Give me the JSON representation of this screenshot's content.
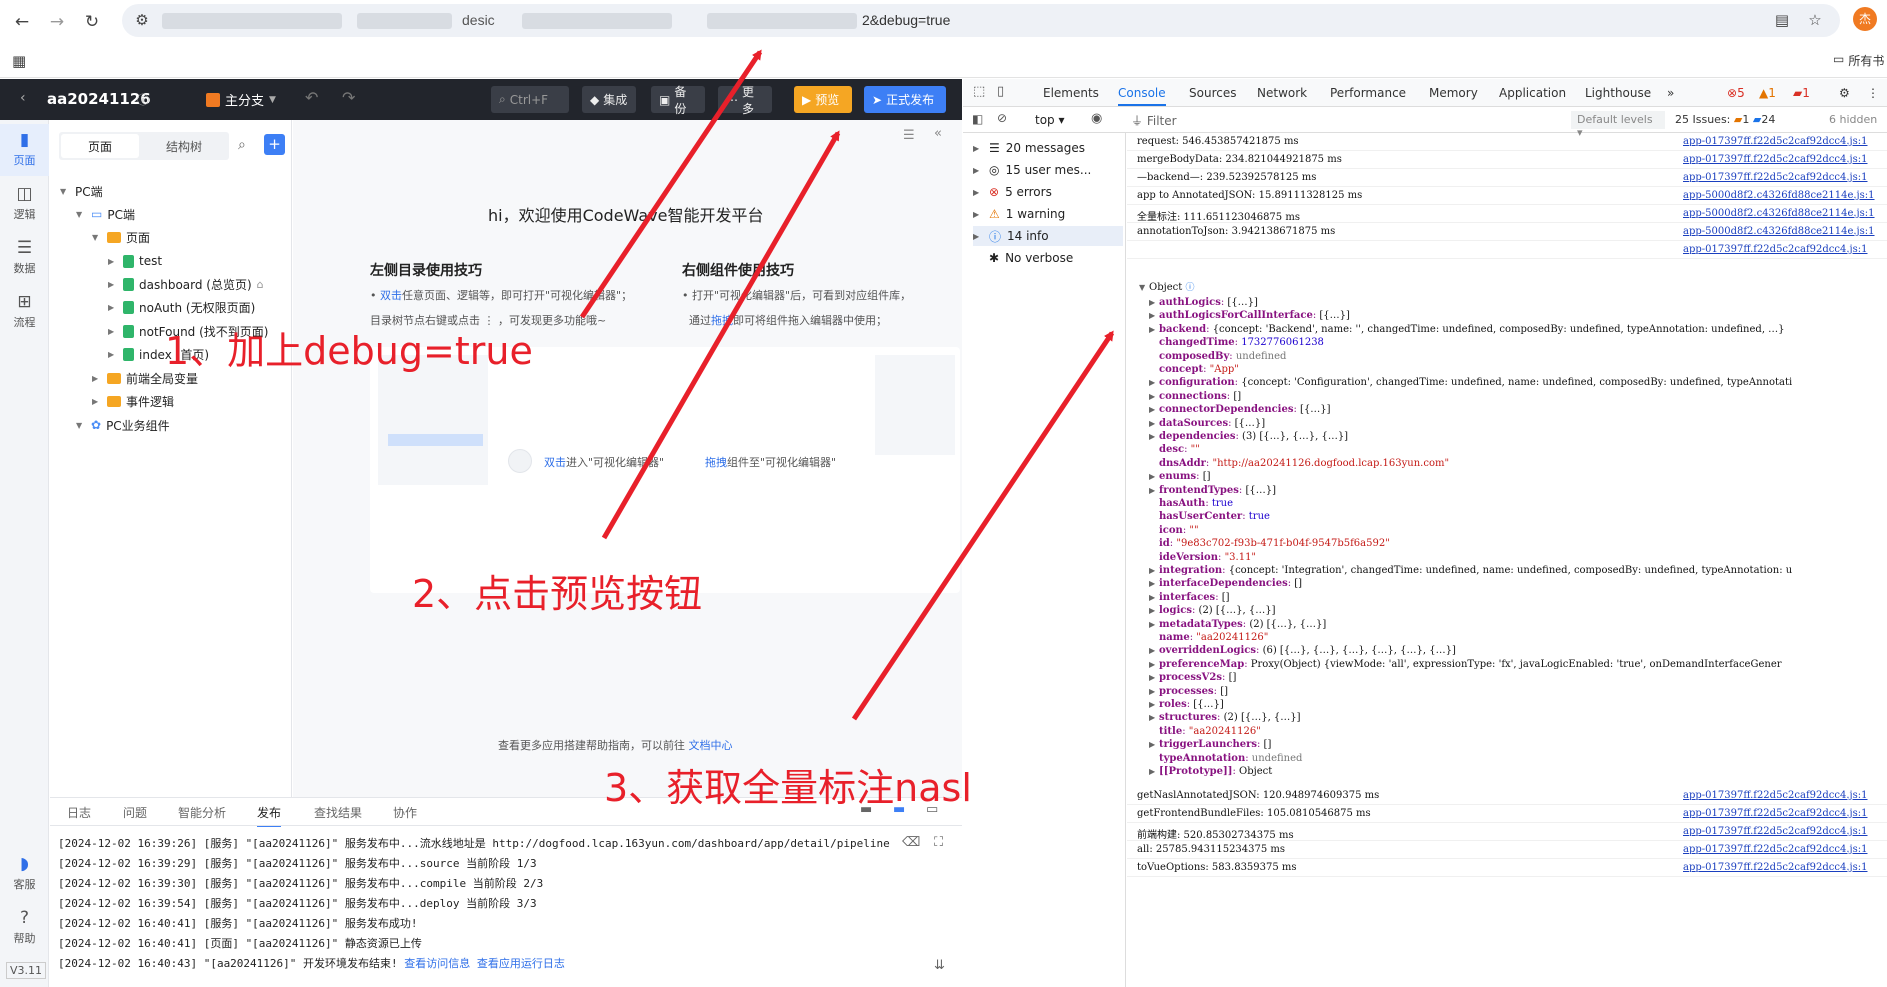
{
  "browser": {
    "url_fragment": "desic",
    "url_tail": "2&debug=true",
    "avatar_text": "杰",
    "bookmark_label": "所有书"
  },
  "ide": {
    "app_name": "aa20241126",
    "branch": "主分支",
    "search_hint": "Ctrl+F",
    "btn_integrate": "集成",
    "btn_backup": "备份",
    "btn_more": "更多",
    "btn_preview": "预览",
    "btn_publish": "正式发布",
    "nav": [
      {
        "label": "页面"
      },
      {
        "label": "逻辑"
      },
      {
        "label": "数据"
      },
      {
        "label": "流程"
      },
      {
        "label": "客服"
      },
      {
        "label": "帮助"
      }
    ],
    "version": "V3.11",
    "tree_tabs": [
      "页面",
      "结构树"
    ],
    "tree": [
      {
        "label": "PC端"
      },
      {
        "label": "PC端"
      },
      {
        "label": "页面"
      },
      {
        "label": "test"
      },
      {
        "label": "dashboard (总览页)"
      },
      {
        "label": "noAuth (无权限页面)"
      },
      {
        "label": "notFound (找不到页面)"
      },
      {
        "label": "index (首页)"
      },
      {
        "label": "前端全局变量"
      },
      {
        "label": "事件逻辑"
      },
      {
        "label": "PC业务组件"
      }
    ],
    "welcome": "hi，欢迎使用CodeWave智能开发平台",
    "tip_left_title": "左侧目录使用技巧",
    "tip_left_1a": "双击",
    "tip_left_1b": "任意页面、逻辑等，即可打开\"可视化编辑器\"；",
    "tip_left_2": "目录树节点右键或点击 ⋮ ，可发现更多功能哦~",
    "tip_right_title": "右侧组件使用技巧",
    "tip_right_1": "打开\"可视化编辑器\"后，可看到对应组件库，",
    "tip_right_2a": "通过",
    "tip_right_2b": "拖拽",
    "tip_right_2c": "即可将组件拖入编辑器中使用；",
    "illus_left_a": "双击",
    "illus_left_b": "进入\"可视化编辑器\"",
    "illus_right_a": "拖拽",
    "illus_right_b": "组件至\"可视化编辑器\"",
    "help_text": "查看更多应用搭建帮助指南，可以前往",
    "help_link": "文档中心",
    "bottom_tabs": [
      "日志",
      "问题",
      "智能分析",
      "发布",
      "查找结果",
      "协作"
    ],
    "logs": [
      "[2024-12-02 16:39:26] [服务] \"[aa20241126]\" 服务发布中...流水线地址是 http://dogfood.lcap.163yun.com/dashboard/app/detail/pipeline",
      "[2024-12-02 16:39:29] [服务] \"[aa20241126]\" 服务发布中...source 当前阶段 1/3",
      "[2024-12-02 16:39:30] [服务] \"[aa20241126]\" 服务发布中...compile 当前阶段 2/3",
      "[2024-12-02 16:39:54] [服务] \"[aa20241126]\" 服务发布中...deploy 当前阶段 3/3",
      "[2024-12-02 16:40:41] [服务] \"[aa20241126]\" 服务发布成功!",
      "[2024-12-02 16:40:41] [页面] \"[aa20241126]\" 静态资源已上传",
      "[2024-12-02 16:40:43]  \"[aa20241126]\" 开发环境发布结束!"
    ],
    "log_link1": "查看访问信息",
    "log_link2": "查看应用运行日志"
  },
  "devtools": {
    "tabs": [
      "Elements",
      "Console",
      "Sources",
      "Network",
      "Performance",
      "Memory",
      "Application",
      "Lighthouse"
    ],
    "err_count": "5",
    "warn_count": "1",
    "issue_count": "1",
    "context": "top",
    "filter_placeholder": "Filter",
    "levels": "Default levels",
    "issues_label": "25 Issues:",
    "issues_a": "1",
    "issues_b": "24",
    "hidden": "6 hidden",
    "sidebar": [
      {
        "label": "20 messages"
      },
      {
        "label": "15 user mes..."
      },
      {
        "label": "5 errors"
      },
      {
        "label": "1 warning"
      },
      {
        "label": "14 info"
      },
      {
        "label": "No verbose"
      }
    ],
    "top_rows": [
      {
        "text": "request: 546.453857421875 ms",
        "src": "app-017397ff.f22d5c2caf92dcc4.js:1"
      },
      {
        "text": "mergeBodyData: 234.821044921875 ms",
        "src": "app-017397ff.f22d5c2caf92dcc4.js:1"
      },
      {
        "text": "—backend—: 239.52392578125 ms",
        "src": "app-017397ff.f22d5c2caf92dcc4.js:1"
      },
      {
        "text": "app to AnnotatedJSON: 15.89111328125 ms",
        "src": "app-5000d8f2.c4326fd88ce2114e.js:1"
      },
      {
        "text": "全量标注: 111.651123046875 ms",
        "src": "app-5000d8f2.c4326fd88ce2114e.js:1"
      },
      {
        "text": "annotationToJson: 3.942138671875 ms",
        "src": "app-5000d8f2.c4326fd88ce2114e.js:1"
      },
      {
        "text": "",
        "src": "app-017397ff.f22d5c2caf92dcc4.js:1"
      }
    ],
    "object_label": "Object",
    "props": [
      {
        "e": true,
        "k": "authLogics",
        "v": "[{…}]"
      },
      {
        "e": true,
        "k": "authLogicsForCallInterface",
        "v": "[{…}]"
      },
      {
        "e": true,
        "k": "backend",
        "v": "{concept: 'Backend', name: '', changedTime: undefined, composedBy: undefined, typeAnnotation: undefined, …}"
      },
      {
        "e": false,
        "k": "changedTime",
        "v": "1732776061238"
      },
      {
        "e": false,
        "k": "composedBy",
        "v": "undefined"
      },
      {
        "e": false,
        "k": "concept",
        "v": "\"App\""
      },
      {
        "e": true,
        "k": "configuration",
        "v": "{concept: 'Configuration', changedTime: undefined, name: undefined, composedBy: undefined, typeAnnotati"
      },
      {
        "e": true,
        "k": "connections",
        "v": "[]"
      },
      {
        "e": true,
        "k": "connectorDependencies",
        "v": "[{…}]"
      },
      {
        "e": true,
        "k": "dataSources",
        "v": "[{…}]"
      },
      {
        "e": true,
        "k": "dependencies",
        "v": "(3)  [{…}, {…}, {…}]"
      },
      {
        "e": false,
        "k": "desc",
        "v": "\"\""
      },
      {
        "e": false,
        "k": "dnsAddr",
        "v": "\"http://aa20241126.dogfood.lcap.163yun.com\""
      },
      {
        "e": true,
        "k": "enums",
        "v": "[]"
      },
      {
        "e": true,
        "k": "frontendTypes",
        "v": "[{…}]"
      },
      {
        "e": false,
        "k": "hasAuth",
        "v": "true"
      },
      {
        "e": false,
        "k": "hasUserCenter",
        "v": "true"
      },
      {
        "e": false,
        "k": "icon",
        "v": "\"\""
      },
      {
        "e": false,
        "k": "id",
        "v": "\"9e83c702-f93b-471f-b04f-9547b5f6a592\""
      },
      {
        "e": false,
        "k": "ideVersion",
        "v": "\"3.11\""
      },
      {
        "e": true,
        "k": "integration",
        "v": "{concept: 'Integration', changedTime: undefined, name: undefined, composedBy: undefined, typeAnnotation: u"
      },
      {
        "e": true,
        "k": "interfaceDependencies",
        "v": "[]"
      },
      {
        "e": true,
        "k": "interfaces",
        "v": "[]"
      },
      {
        "e": true,
        "k": "logics",
        "v": "(2)  [{…}, {…}]"
      },
      {
        "e": true,
        "k": "metadataTypes",
        "v": "(2)  [{…}, {…}]"
      },
      {
        "e": false,
        "k": "name",
        "v": "\"aa20241126\""
      },
      {
        "e": true,
        "k": "overriddenLogics",
        "v": "(6)  [{…}, {…}, {…}, {…}, {…}, {…}]"
      },
      {
        "e": true,
        "k": "preferenceMap",
        "v": "Proxy(Object)  {viewMode: 'all', expressionType: 'fx', javaLogicEnabled: 'true', onDemandInterfaceGener"
      },
      {
        "e": true,
        "k": "processV2s",
        "v": "[]"
      },
      {
        "e": true,
        "k": "processes",
        "v": "[]"
      },
      {
        "e": true,
        "k": "roles",
        "v": "[{…}]"
      },
      {
        "e": true,
        "k": "structures",
        "v": "(2)  [{…}, {…}]"
      },
      {
        "e": false,
        "k": "title",
        "v": "\"aa20241126\""
      },
      {
        "e": true,
        "k": "triggerLaunchers",
        "v": "[]"
      },
      {
        "e": false,
        "k": "typeAnnotation",
        "v": "undefined"
      },
      {
        "e": true,
        "k": "[[Prototype]]",
        "v": "Object"
      }
    ],
    "bottom_rows": [
      {
        "text": "getNaslAnnotatedJSON: 120.948974609375 ms",
        "src": "app-017397ff.f22d5c2caf92dcc4.js:1"
      },
      {
        "text": "getFrontendBundleFiles: 105.0810546875 ms",
        "src": "app-017397ff.f22d5c2caf92dcc4.js:1"
      },
      {
        "text": "前端构建: 520.85302734375 ms",
        "src": "app-017397ff.f22d5c2caf92dcc4.js:1"
      },
      {
        "text": "all: 25785.943115234375 ms",
        "src": "app-017397ff.f22d5c2caf92dcc4.js:1"
      },
      {
        "text": "toVueOptions: 583.8359375 ms",
        "src": "app-017397ff.f22d5c2caf92dcc4.js:1"
      }
    ]
  },
  "annotations": {
    "step1": "1、加上debug=true",
    "step2": "2、点击预览按钮",
    "step3": "3、获取全量标注nasl",
    "color": "#e8202a"
  }
}
